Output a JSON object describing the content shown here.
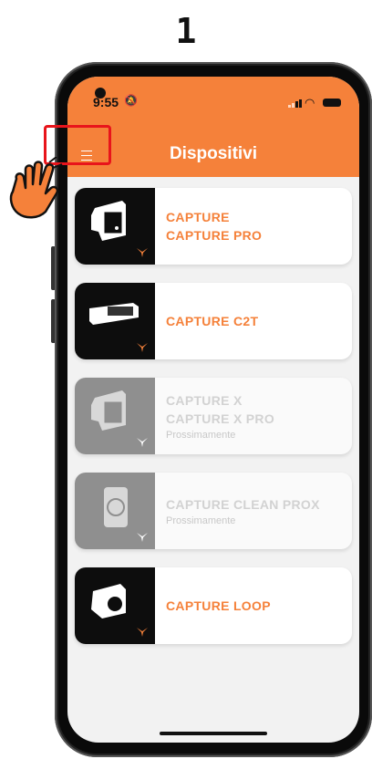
{
  "step": "1",
  "status_bar": {
    "time": "9:55"
  },
  "header": {
    "title": "Dispositivi"
  },
  "devices": [
    {
      "lines": [
        "CAPTURE",
        "CAPTURE PRO"
      ],
      "subtitle": "",
      "available": true,
      "device_icon": "capture-device-icon"
    },
    {
      "lines": [
        "CAPTURE C2T"
      ],
      "subtitle": "",
      "available": true,
      "device_icon": "capture-c2t-device-icon"
    },
    {
      "lines": [
        "CAPTURE X",
        "CAPTURE X PRO"
      ],
      "subtitle": "Prossimamente",
      "available": false,
      "device_icon": "capture-x-device-icon"
    },
    {
      "lines": [
        "CAPTURE CLEAN PROX"
      ],
      "subtitle": "Prossimamente",
      "available": false,
      "device_icon": "capture-clean-prox-device-icon"
    },
    {
      "lines": [
        "CAPTURE LOOP"
      ],
      "subtitle": "",
      "available": true,
      "device_icon": "capture-loop-device-icon"
    }
  ],
  "colors": {
    "accent": "#f5813a",
    "highlight": "#e8141b",
    "disabled_text": "#d2d2d2"
  }
}
